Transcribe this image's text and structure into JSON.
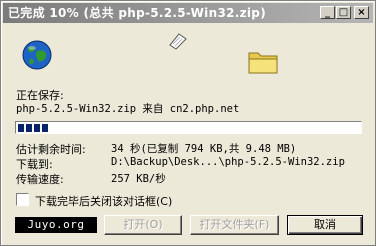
{
  "window": {
    "title": "已完成 10% (总共 php-5.2.5-Win32.zip)",
    "controls": {
      "minimize": "_",
      "maximize": "□",
      "close": "×"
    }
  },
  "status": {
    "saving_label": "正在保存:",
    "file_line": "php-5.2.5-Win32.zip 来自 cn2.php.net"
  },
  "progress": {
    "percent": 10
  },
  "details": {
    "time_left_label": "估计剩余时间:",
    "time_left_value": "34 秒(已复制 794 KB,共 9.48 MB)",
    "download_to_label": "下载到:",
    "download_to_value": "D:\\Backup\\Desk...\\php-5.2.5-Win32.zip",
    "rate_label": "传输速度:",
    "rate_value": "257 KB/秒"
  },
  "close_on_complete": {
    "label": "下载完毕后关闭该对话框(C)",
    "checked": false
  },
  "watermark": "Juyo.org",
  "buttons": {
    "open": "打开(O)",
    "open_folder": "打开文件夹(F)",
    "cancel": "取消"
  },
  "icons": {
    "globe": "globe-icon",
    "paper": "flying-document-icon",
    "folder": "folder-icon"
  }
}
